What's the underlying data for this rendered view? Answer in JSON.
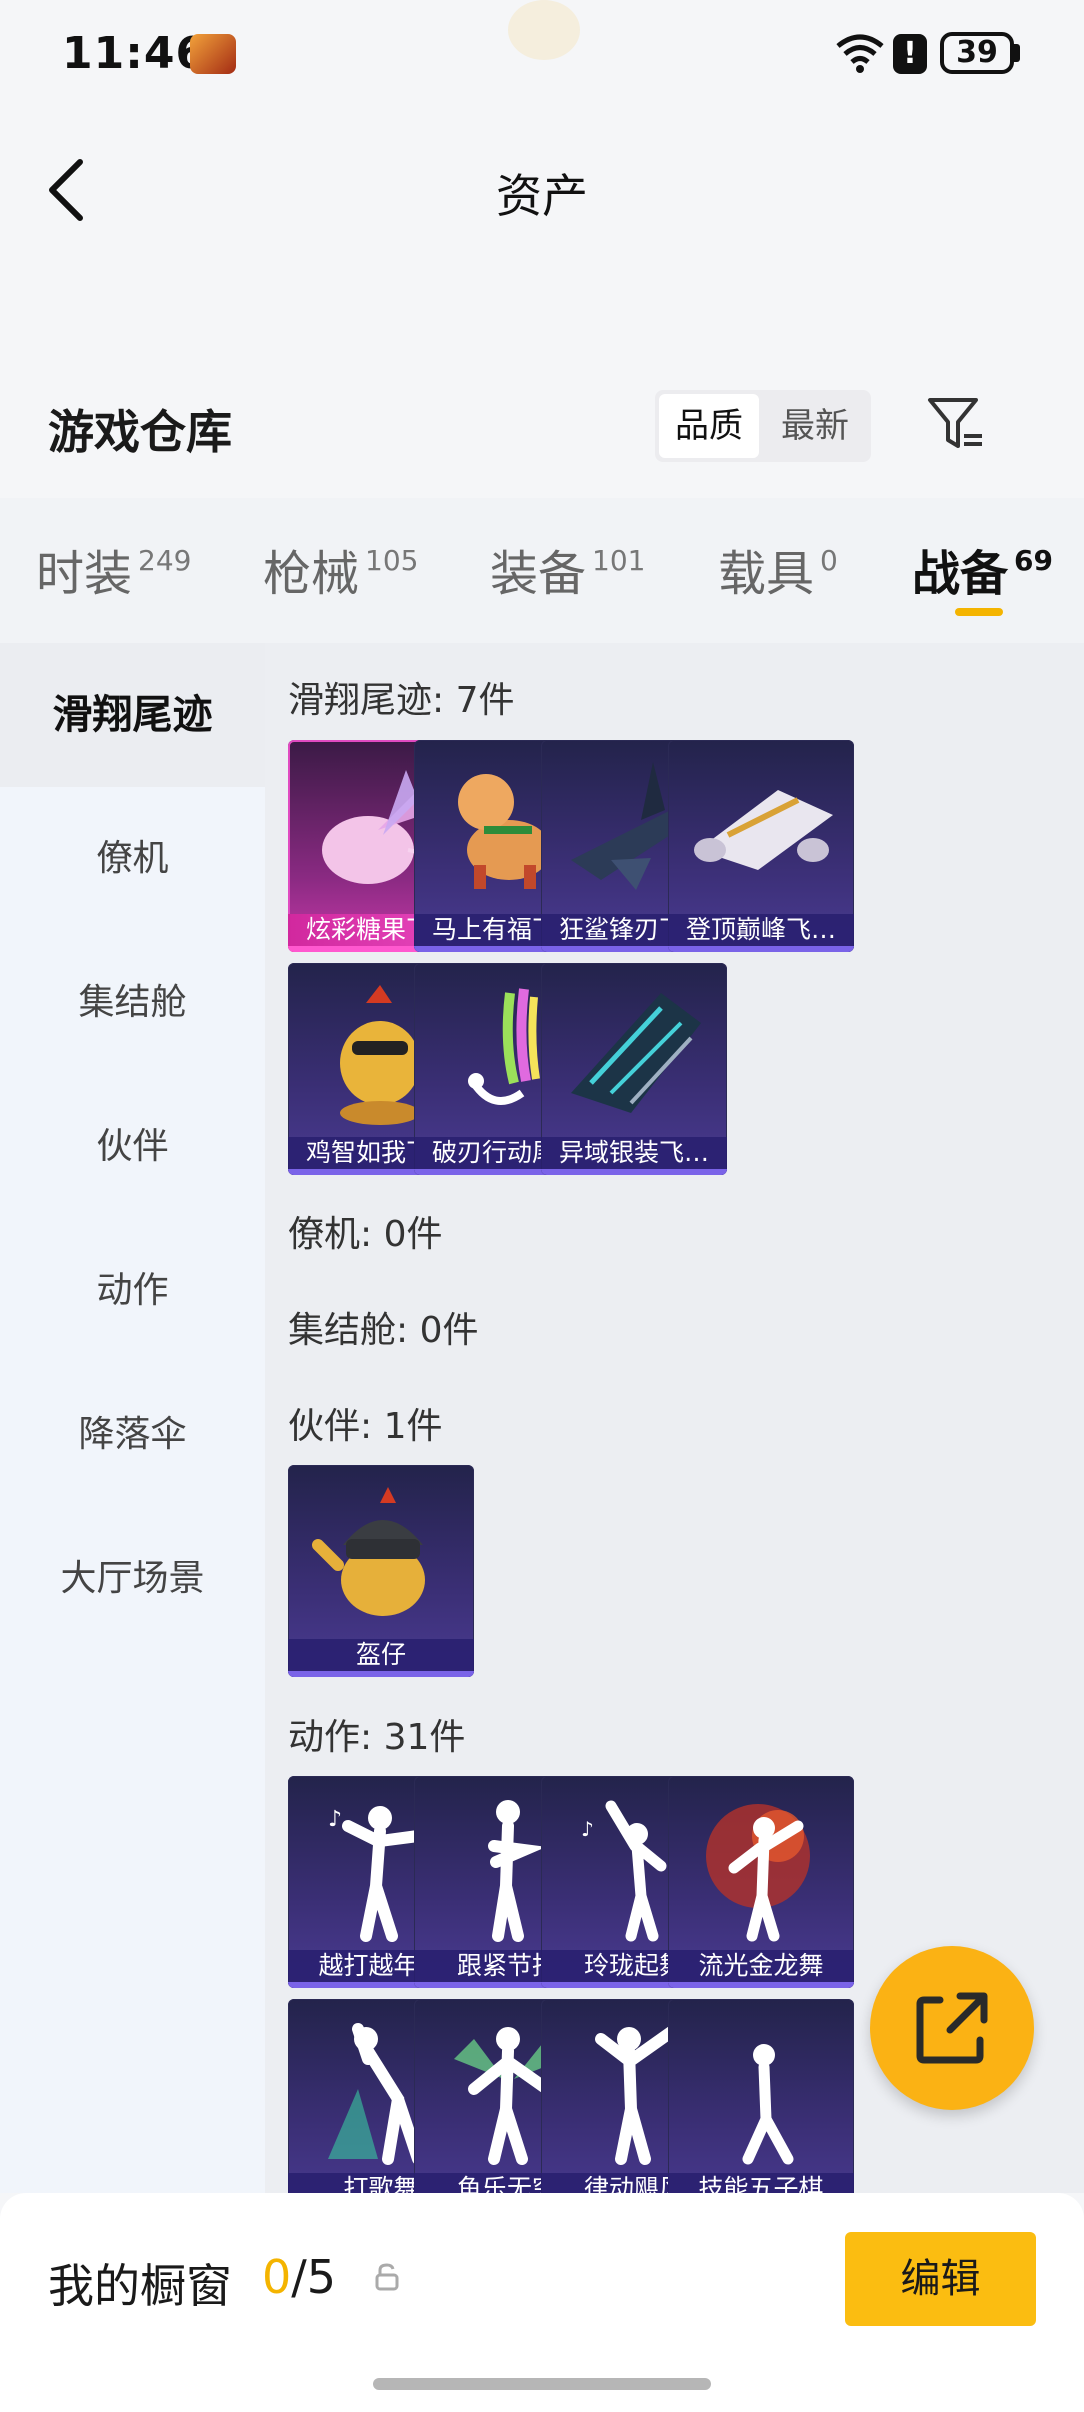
{
  "status_bar": {
    "time": "11:46",
    "alert": "!",
    "battery": "39"
  },
  "header": {
    "title": "资产"
  },
  "warehouse": {
    "title": "游戏仓库",
    "sort": {
      "quality": "品质",
      "latest": "最新"
    }
  },
  "tabs": [
    {
      "label": "时装",
      "count": "249"
    },
    {
      "label": "枪械",
      "count": "105"
    },
    {
      "label": "装备",
      "count": "101"
    },
    {
      "label": "载具",
      "count": "0"
    },
    {
      "label": "战备",
      "count": "69"
    }
  ],
  "sidebar": {
    "items": [
      "滑翔尾迹",
      "僚机",
      "集结舱",
      "伙伴",
      "动作",
      "降落伞",
      "大厅场景"
    ]
  },
  "groups": {
    "trail": {
      "title": "滑翔尾迹: 7件",
      "items": [
        "炫彩糖果飞…",
        "马上有福飞…",
        "狂鲨锋刃飞…",
        "登顶巅峰飞…",
        "鸡智如我飞…",
        "破刃行动尾迹",
        "异域银装飞…"
      ]
    },
    "wingman": {
      "title": "僚机: 0件"
    },
    "capsule": {
      "title": "集结舱: 0件"
    },
    "partner": {
      "title": "伙伴: 1件",
      "items": [
        "盔仔"
      ]
    },
    "emote": {
      "title": "动作: 31件",
      "items": [
        "越打越年轻",
        "跟紧节拍",
        "玲珑起舞",
        "流光金龙舞",
        "打歌舞",
        "鱼乐无穷",
        "律动飓风",
        "技能五子棋"
      ]
    }
  },
  "bottom": {
    "showcase_title": "我的橱窗",
    "showcase_current": "0",
    "showcase_sep": "/",
    "showcase_total": "5",
    "edit_label": "编辑"
  },
  "colors": {
    "accent": "#f4b400",
    "button": "#fbbd11",
    "card_purple": "#3b2f76",
    "card_pink": "#c739a8"
  }
}
